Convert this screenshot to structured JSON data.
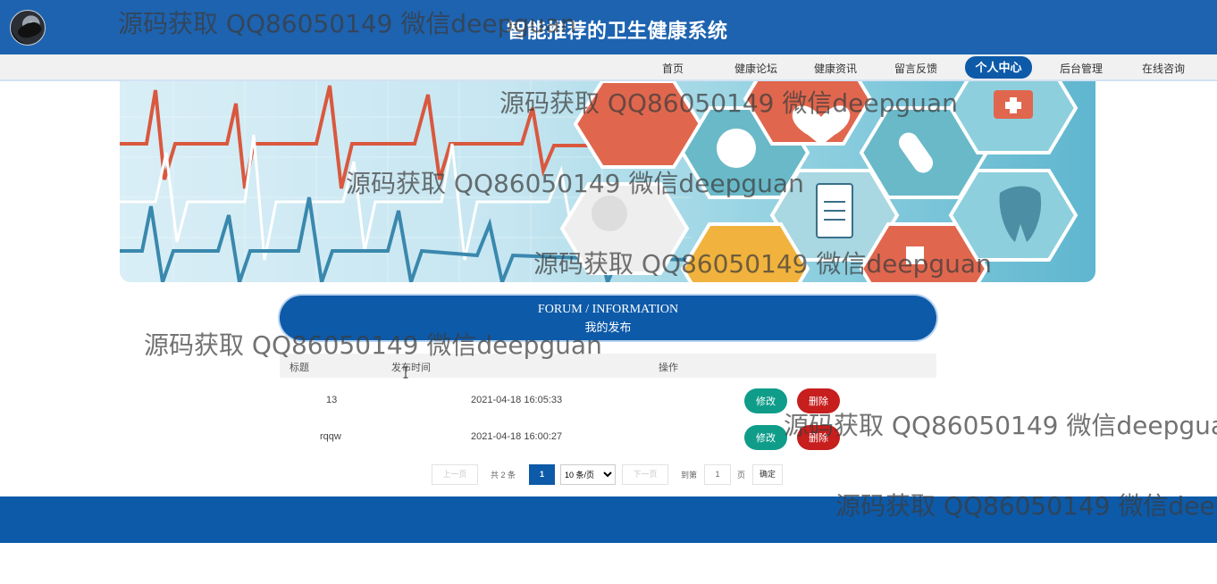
{
  "header": {
    "title": "智能推荐的卫生健康系统",
    "avatar_icon": "avatar-icon"
  },
  "nav": {
    "items": [
      {
        "label": "首页",
        "active": false
      },
      {
        "label": "健康论坛",
        "active": false
      },
      {
        "label": "健康资讯",
        "active": false
      },
      {
        "label": "留言反馈",
        "active": false
      },
      {
        "label": "个人中心",
        "active": true
      },
      {
        "label": "后台管理",
        "active": false
      },
      {
        "label": "在线咨询",
        "active": false
      }
    ]
  },
  "section": {
    "title_en": "FORUM / INFORMATION",
    "title_cn": "我的发布"
  },
  "table": {
    "columns": [
      "标题",
      "发布时间",
      "操作"
    ],
    "rows": [
      {
        "title": "13",
        "time": "2021-04-18 16:05:33",
        "edit": "修改",
        "delete": "删除"
      },
      {
        "title": "rqqw",
        "time": "2021-04-18 16:00:27",
        "edit": "修改",
        "delete": "删除"
      }
    ]
  },
  "pagination": {
    "prev": "上一页",
    "total": "共 2 条",
    "current_page": "1",
    "page_size_selected": "10 条/页",
    "next": "下一页",
    "goto_label": "到第",
    "goto_value": "1",
    "page_unit": "页",
    "confirm": "确定"
  },
  "watermark": {
    "text": "源码获取 QQ86050149 微信deepguan"
  },
  "colors": {
    "primary": "#0d5aa9",
    "header": "#1d63b0",
    "edit": "#0f9d8a",
    "delete": "#c71e1e"
  }
}
